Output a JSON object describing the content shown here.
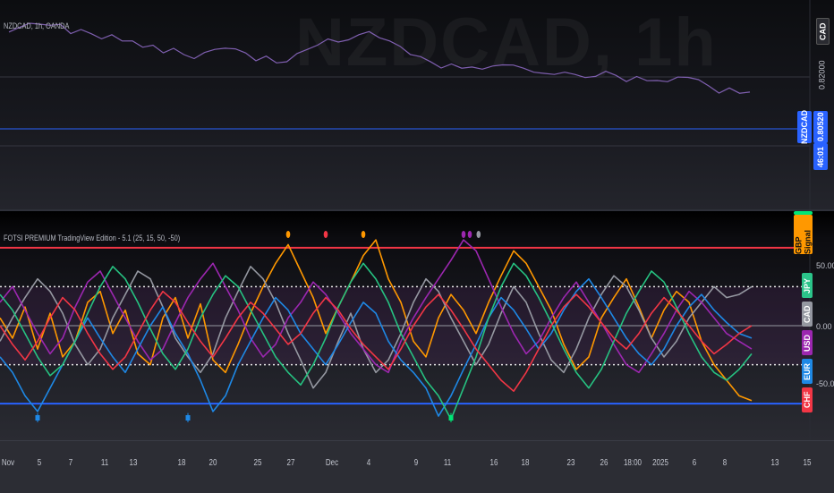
{
  "price_pane": {
    "legend": "NZDCAD, 1h, OANDA",
    "watermark": "NZDCAD, 1h",
    "currency_label": "CAD",
    "price_label": "0.82000",
    "last_symbol": "NZDCAD",
    "last_price": "0.80520",
    "countdown": "46:01",
    "line_color": "#7f5fb0",
    "accent": "#2962ff"
  },
  "osc_pane": {
    "legend": "FOTSI PREMIUM TradingView Edition - 5.1 (25, 15, 50, -50)",
    "gbp_signal": "GBP Signal",
    "axis_labels": [
      "50.00",
      "0.00",
      "-50.00"
    ],
    "currency_tags": [
      {
        "label": "JPY",
        "color": "#2bc48a"
      },
      {
        "label": "CAD",
        "color": "#9598a1"
      },
      {
        "label": "USD",
        "color": "#9c27b0"
      },
      {
        "label": "EUR",
        "color": "#1e88e5"
      },
      {
        "label": "CHF",
        "color": "#f23645"
      }
    ],
    "series_colors": {
      "orange": "#ff9800",
      "gray": "#9598a1",
      "purple": "#9c27b0",
      "blue": "#1e88e5",
      "green": "#26c281",
      "red": "#f23645",
      "gbp_green": "#00e676"
    },
    "overbought_color": "#f23645",
    "oversold_color": "#2962ff"
  },
  "chart_data": {
    "type": "line",
    "price_range": [
      0.802,
      0.826
    ],
    "price_line": [
      0.8235,
      0.824,
      0.8248,
      0.825,
      0.8244,
      0.8246,
      0.8232,
      0.8236,
      0.8228,
      0.8222,
      0.8226,
      0.8214,
      0.8218,
      0.8202,
      0.8206,
      0.8195,
      0.82,
      0.8188,
      0.8184,
      0.8192,
      0.8198,
      0.8204,
      0.8199,
      0.8191,
      0.818,
      0.8185,
      0.8172,
      0.8178,
      0.819,
      0.8198,
      0.821,
      0.8218,
      0.8212,
      0.822,
      0.8226,
      0.8232,
      0.8224,
      0.8214,
      0.8204,
      0.8192,
      0.8184,
      0.8174,
      0.8166,
      0.817,
      0.8162,
      0.8168,
      0.816,
      0.8166,
      0.8172,
      0.8168,
      0.8162,
      0.8158,
      0.8152,
      0.815,
      0.8158,
      0.815,
      0.8144,
      0.815,
      0.8156,
      0.8148,
      0.814,
      0.8146,
      0.8138,
      0.8142,
      0.8136,
      0.8145,
      0.8148,
      0.814,
      0.8128,
      0.8118,
      0.8124,
      0.8114,
      0.812
    ],
    "axis_range": [
      -70,
      70
    ],
    "overbought": 50,
    "oversold": -50,
    "upper_band": 25,
    "lower_band": -25,
    "zero": 0,
    "series": [
      {
        "color_key": "orange",
        "values": [
          5,
          -8,
          12,
          -15,
          8,
          -20,
          -10,
          15,
          22,
          -5,
          10,
          -18,
          -25,
          5,
          18,
          -8,
          14,
          -22,
          -30,
          -12,
          8,
          25,
          40,
          52,
          35,
          18,
          -5,
          12,
          28,
          45,
          55,
          30,
          15,
          -10,
          -20,
          5,
          20,
          10,
          -5,
          15,
          32,
          48,
          40,
          25,
          10,
          -12,
          -28,
          -20,
          5,
          18,
          30,
          12,
          -8,
          10,
          22,
          15,
          -10,
          -25,
          -35,
          -45,
          -48
        ]
      },
      {
        "color_key": "gray",
        "values": [
          -10,
          5,
          18,
          30,
          22,
          8,
          -12,
          -25,
          -15,
          5,
          20,
          35,
          30,
          12,
          -8,
          -20,
          -30,
          -18,
          5,
          22,
          38,
          30,
          15,
          -5,
          -22,
          -40,
          -30,
          -10,
          8,
          -15,
          -30,
          -22,
          -5,
          15,
          30,
          22,
          5,
          -10,
          -25,
          -12,
          8,
          25,
          15,
          -5,
          -22,
          -30,
          -15,
          5,
          20,
          32,
          25,
          10,
          -8,
          -20,
          -10,
          5,
          15,
          25,
          18,
          20,
          25
        ]
      },
      {
        "color_key": "purple",
        "values": [
          15,
          25,
          10,
          -5,
          -18,
          -8,
          12,
          28,
          35,
          20,
          5,
          -10,
          -22,
          -15,
          2,
          18,
          30,
          40,
          25,
          10,
          -8,
          -20,
          -12,
          5,
          15,
          28,
          20,
          8,
          -5,
          -15,
          -25,
          -30,
          -10,
          5,
          18,
          30,
          42,
          55,
          48,
          30,
          12,
          -5,
          -18,
          -10,
          5,
          18,
          28,
          15,
          2,
          -12,
          -25,
          -30,
          -18,
          -5,
          10,
          22,
          15,
          5,
          -5,
          -10,
          -15
        ]
      },
      {
        "color_key": "blue",
        "values": [
          -20,
          -30,
          -45,
          -55,
          -40,
          -25,
          -10,
          5,
          -8,
          -20,
          -30,
          -15,
          0,
          12,
          -5,
          -18,
          -35,
          -55,
          -45,
          -25,
          -10,
          5,
          18,
          10,
          -5,
          -15,
          -25,
          -12,
          2,
          15,
          8,
          -10,
          -22,
          -30,
          -40,
          -58,
          -45,
          -28,
          -12,
          5,
          18,
          10,
          -2,
          -15,
          -5,
          10,
          22,
          30,
          18,
          5,
          -8,
          -18,
          -25,
          -15,
          0,
          12,
          20,
          10,
          2,
          -5,
          -8
        ]
      },
      {
        "color_key": "green",
        "values": [
          20,
          10,
          -5,
          -20,
          -32,
          -25,
          -10,
          8,
          25,
          38,
          30,
          15,
          -2,
          -18,
          -28,
          -15,
          5,
          20,
          32,
          25,
          10,
          -5,
          -20,
          -30,
          -38,
          -25,
          -8,
          12,
          28,
          40,
          30,
          15,
          -5,
          -20,
          -35,
          -45,
          -60,
          -40,
          -20,
          5,
          25,
          40,
          32,
          18,
          2,
          -15,
          -30,
          -40,
          -28,
          -10,
          8,
          22,
          35,
          28,
          12,
          -5,
          -20,
          -30,
          -35,
          -28,
          -18
        ]
      },
      {
        "color_key": "red",
        "values": [
          0,
          -12,
          -22,
          -10,
          5,
          18,
          10,
          -5,
          -18,
          -28,
          -20,
          -5,
          10,
          22,
          15,
          2,
          -10,
          -20,
          -8,
          5,
          15,
          8,
          -2,
          -12,
          -5,
          8,
          18,
          10,
          -2,
          -12,
          -20,
          -28,
          -15,
          0,
          12,
          20,
          10,
          -2,
          -15,
          -25,
          -35,
          -42,
          -30,
          -15,
          0,
          12,
          20,
          12,
          2,
          -8,
          -15,
          -5,
          8,
          18,
          10,
          0,
          -10,
          -18,
          -12,
          -5,
          0
        ]
      }
    ],
    "signal_dots_top": [
      {
        "i": 23,
        "color_key": "orange"
      },
      {
        "i": 26,
        "color_key": "red"
      },
      {
        "i": 29,
        "color_key": "orange"
      },
      {
        "i": 37,
        "color_key": "purple"
      },
      {
        "i": 37.5,
        "color_key": "purple"
      },
      {
        "i": 38.2,
        "color_key": "gray"
      }
    ],
    "signal_markers_bottom": [
      {
        "i": 3,
        "color_key": "blue"
      },
      {
        "i": 15,
        "color_key": "blue"
      },
      {
        "i": 36,
        "color_key": "gbp_green"
      }
    ],
    "time_ticks": [
      "Nov",
      "5",
      "7",
      "11",
      "13",
      "18",
      "20",
      "25",
      "27",
      "Dec",
      "4",
      "9",
      "11",
      "16",
      "18",
      "23",
      "26",
      "18:00",
      "2025",
      "6",
      "8",
      "13",
      "15"
    ]
  }
}
